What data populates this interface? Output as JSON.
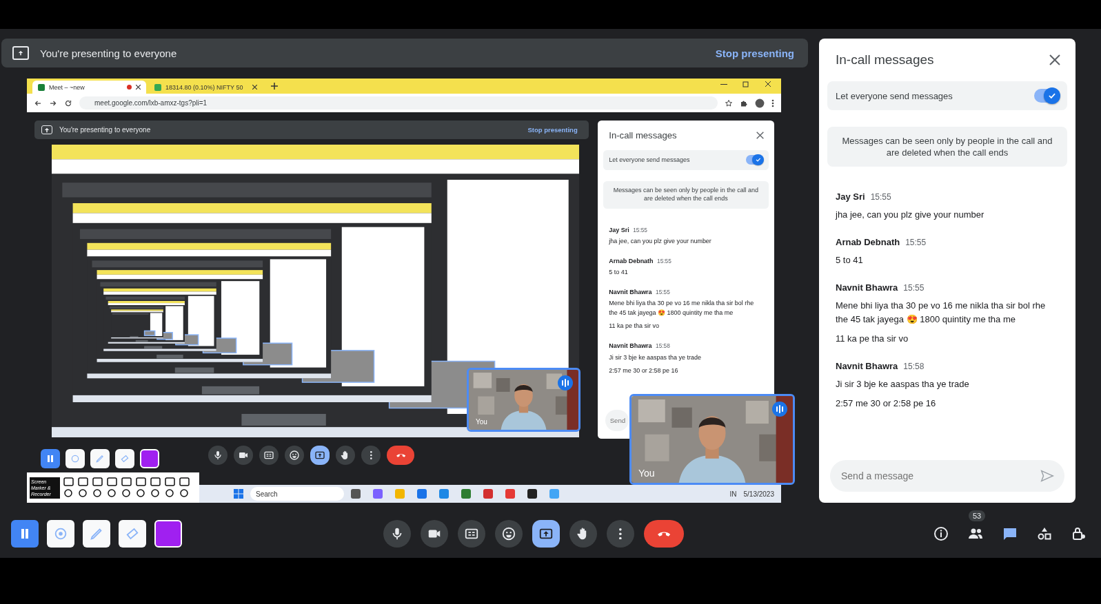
{
  "presenting_bar": {
    "text": "You're presenting to everyone",
    "action": "Stop presenting"
  },
  "shared_screen": {
    "tabs": [
      {
        "title": "Meet – ~new",
        "selected": true,
        "recording": true
      },
      {
        "title": "18314.80 (0.10%) NIFTY 50",
        "selected": false,
        "recording": false
      }
    ],
    "address": "meet.google.com/lxb-amxz-tgs?pli=1",
    "presenting_bar": {
      "text": "You're presenting to everyone",
      "action": "Stop presenting"
    },
    "chat": {
      "title": "In-call messages",
      "toggle_label": "Let everyone send messages",
      "toggle_on": true,
      "notice": "Messages can be seen only by people in the call and are deleted when the call ends",
      "messages": [
        {
          "sender": "Jay Sri",
          "time": "15:55",
          "lines": [
            "jha jee, can you plz give your number"
          ]
        },
        {
          "sender": "Arnab Debnath",
          "time": "15:55",
          "lines": [
            "5 to 41"
          ]
        },
        {
          "sender": "Navnit Bhawra",
          "time": "15:55",
          "lines": [
            "Mene bhi liya tha 30 pe vo 16 me nikla tha sir bol rhe the 45 tak jayega 😍 1800 quintity me tha me",
            "11 ka pe tha sir vo"
          ]
        },
        {
          "sender": "Navnit Bhawra",
          "time": "15:58",
          "lines": [
            "Ji sir 3 bje ke aaspas tha ye trade",
            "2:57 me 30 or 2:58 pe 16"
          ]
        }
      ],
      "placeholder": "Send"
    },
    "self_view": {
      "label": "You"
    },
    "controls": [
      {
        "kind": "mic",
        "active": false
      },
      {
        "kind": "camera",
        "active": false
      },
      {
        "kind": "captions",
        "active": false
      },
      {
        "kind": "emoji",
        "active": false
      },
      {
        "kind": "present",
        "active": true
      },
      {
        "kind": "hand",
        "active": false
      },
      {
        "kind": "more",
        "active": false
      },
      {
        "kind": "end"
      }
    ],
    "marker_logo": "Screen Marker & Recorder",
    "taskbar": {
      "search": "Search",
      "language": "IN",
      "date": "5/13/2023"
    }
  },
  "chat": {
    "title": "In-call messages",
    "toggle_label": "Let everyone send messages",
    "toggle_on": true,
    "notice": "Messages can be seen only by people in the call and are deleted when the call ends",
    "messages": [
      {
        "sender": "Jay Sri",
        "time": "15:55",
        "lines": [
          "jha jee, can you plz give your number"
        ]
      },
      {
        "sender": "Arnab Debnath",
        "time": "15:55",
        "lines": [
          "5 to 41"
        ]
      },
      {
        "sender": "Navnit Bhawra",
        "time": "15:55",
        "lines": [
          "Mene bhi liya tha 30 pe vo 16 me nikla tha sir bol rhe the 45 tak jayega 😍 1800 quintity me tha me",
          "11 ka pe tha sir vo"
        ]
      },
      {
        "sender": "Navnit Bhawra",
        "time": "15:58",
        "lines": [
          "Ji sir 3 bje ke aaspas tha ye trade",
          "2:57 me 30 or 2:58 pe 16"
        ]
      }
    ],
    "placeholder": "Send a message"
  },
  "self_view": {
    "label": "You"
  },
  "controls": [
    {
      "kind": "mic",
      "active": false
    },
    {
      "kind": "camera",
      "active": false
    },
    {
      "kind": "captions",
      "active": false
    },
    {
      "kind": "emoji",
      "active": false
    },
    {
      "kind": "present",
      "active": true
    },
    {
      "kind": "hand",
      "active": false
    },
    {
      "kind": "more",
      "active": false
    },
    {
      "kind": "end"
    }
  ],
  "side_icons": [
    {
      "kind": "info",
      "active": false
    },
    {
      "kind": "people",
      "active": false,
      "badge": "53"
    },
    {
      "kind": "chat",
      "active": true
    },
    {
      "kind": "activities",
      "active": false
    },
    {
      "kind": "lock",
      "active": false
    }
  ]
}
